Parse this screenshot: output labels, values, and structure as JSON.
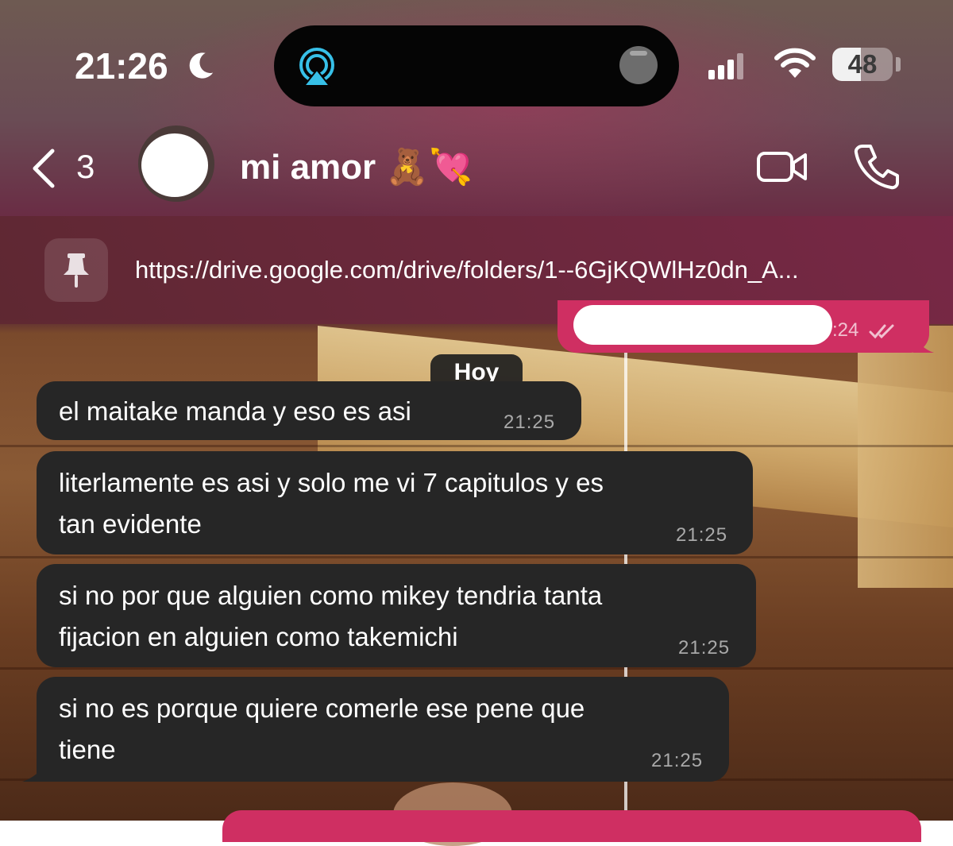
{
  "status_bar": {
    "time": "21:26",
    "battery_level": "48",
    "battery_fraction": 0.48,
    "icons": [
      "moon-icon",
      "airplay-icon",
      "signal-icon",
      "wifi-icon",
      "battery-icon"
    ]
  },
  "header": {
    "back_count": "3",
    "contact_name": "mi amor 🧸💘",
    "icons": [
      "back-chevron-icon",
      "video-call-icon",
      "phone-call-icon"
    ]
  },
  "pinned": {
    "text": "https://drive.google.com/drive/folders/1--6GjKQWlHz0dn_A...",
    "icon": "pin-icon"
  },
  "outgoing_top": {
    "time": ":24"
  },
  "day_separator": "Hoy",
  "messages": [
    {
      "lines": [
        "el maitake manda y eso es asi"
      ],
      "time": "21:25"
    },
    {
      "lines": [
        "literlamente es asi y solo me vi 7 capitulos y es",
        "tan evidente"
      ],
      "time": "21:25"
    },
    {
      "lines": [
        "si no por que alguien como mikey tendria tanta",
        "fijacion en alguien como takemichi"
      ],
      "time": "21:25"
    },
    {
      "lines": [
        "si no es porque quiere comerle ese pene que",
        "tiene"
      ],
      "time": "21:25"
    }
  ],
  "colors": {
    "outgoing_bubble": "#cf2f62",
    "incoming_bubble": "#262626",
    "airplay_accent": "#37c0e8"
  }
}
